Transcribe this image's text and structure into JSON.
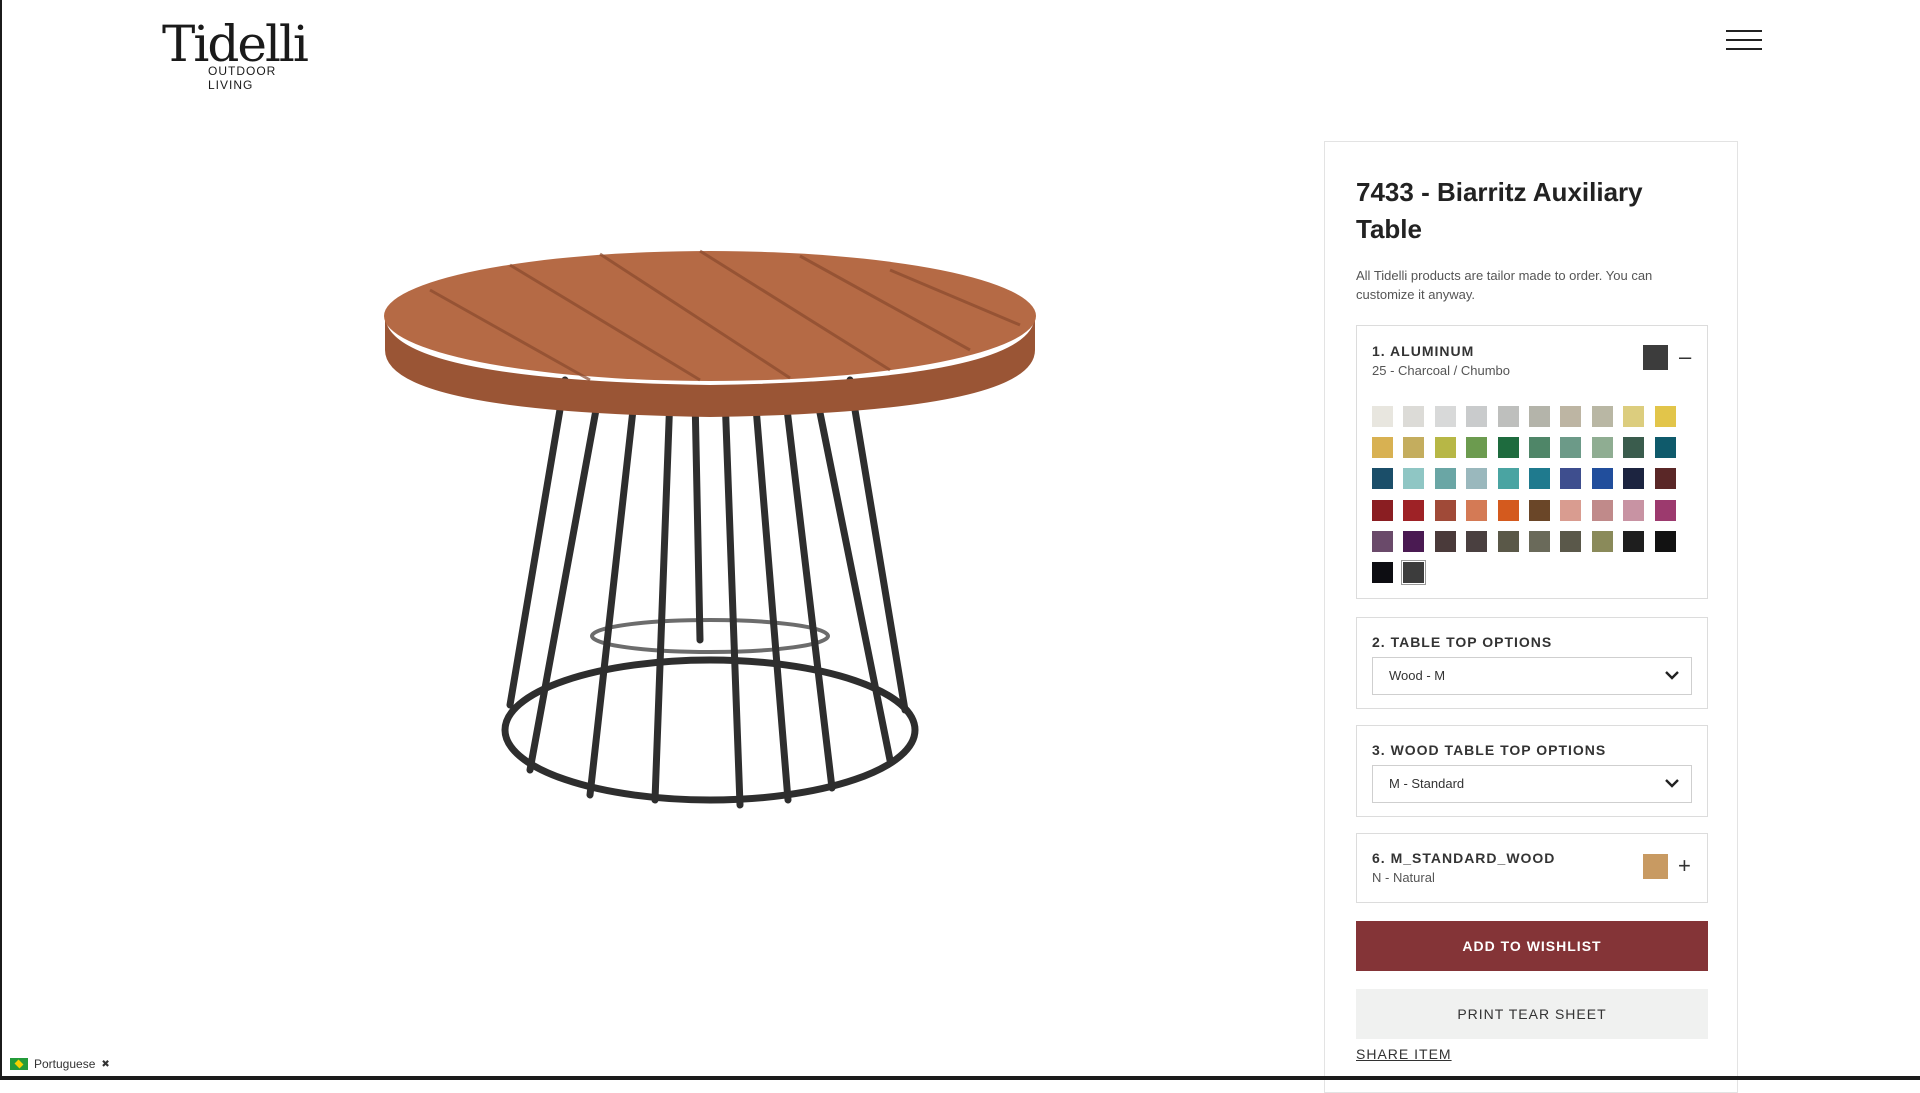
{
  "header": {
    "logo_word": "Tidelli",
    "logo_tagline": "OUTDOOR LIVING"
  },
  "product": {
    "title": "7433 - Biarritz Auxiliary Table",
    "intro": "All Tidelli products are tailor made to order. You can customize it anyway."
  },
  "options": {
    "aluminum": {
      "label": "1. ALUMINUM",
      "selected": "25 - Charcoal / Chumbo",
      "selected_color": "#3c3c3c",
      "toggle": "–",
      "swatches": [
        "#e8e6df",
        "#dcdbd7",
        "#d8d9d9",
        "#c9cbcc",
        "#bebfbd",
        "#b4b4aa",
        "#bdb5a3",
        "#b9b7a4",
        "#dccd7e",
        "#e2c54a",
        "#d8b152",
        "#c4ad5e",
        "#b7b746",
        "#6c9b4f",
        "#1e6b3e",
        "#4f8668",
        "#6c9a88",
        "#8fad92",
        "#3a5c4d",
        "#0f5a6b",
        "#1b4e69",
        "#8fc6c4",
        "#6aa6a5",
        "#9ab8bd",
        "#4aa4a2",
        "#1f7a8e",
        "#3e4e8e",
        "#214e9c",
        "#1c2440",
        "#5a2727",
        "#8a1e22",
        "#9e2226",
        "#a04a38",
        "#d47a55",
        "#d45a1e",
        "#6a4628",
        "#d99c90",
        "#c08a8a",
        "#c893a3",
        "#9c3a6e",
        "#6a4a6a",
        "#4a1a52",
        "#4a3a3a",
        "#4a4040",
        "#5a5848",
        "#6a6a5a",
        "#5a584a",
        "#8a8a5a",
        "#1e1e1e",
        "#121212",
        "#0d0d12",
        "#3c3c3c"
      ],
      "selected_index": 51
    },
    "table_top": {
      "label": "2. TABLE TOP OPTIONS",
      "value": "Wood - M"
    },
    "wood_top": {
      "label": "3. WOOD TABLE TOP OPTIONS",
      "value": "M - Standard"
    },
    "wood": {
      "label": "6. M_STANDARD_WOOD",
      "selected": "N - Natural",
      "selected_color": "#c89a62",
      "toggle": "+"
    }
  },
  "actions": {
    "wishlist": "ADD TO WISHLIST",
    "print": "PRINT TEAR SHEET",
    "share": "SHARE ITEM"
  },
  "language": {
    "label": "Portuguese",
    "close": "✖"
  },
  "colors": {
    "accent": "#843437",
    "wood_top": "#b56a45",
    "frame": "#2a2a2a"
  }
}
